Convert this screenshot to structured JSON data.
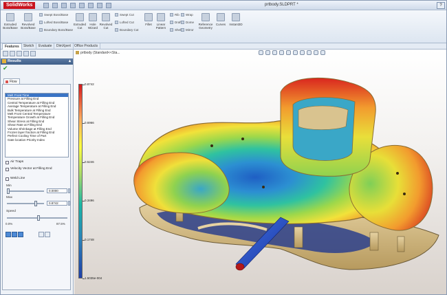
{
  "app": {
    "logo": "SolidWorks",
    "document_title": "prtbody.SLDPRT *",
    "help": "?"
  },
  "ribbon": {
    "commands": [
      "Extruded Boss/Base",
      "Revolved Boss/Base",
      "Extruded Cut",
      "Hole Wizard",
      "Revolved Cut",
      "Fillet",
      "Linear Pattern",
      "Reference Geometry",
      "Curves",
      "Instant3D"
    ],
    "small_commands": [
      "Swept Boss/Base",
      "Lofted Boss/Base",
      "Boundary Boss/Base",
      "Swept Cut",
      "Lofted Cut",
      "Boundary Cut",
      "Rib",
      "Draft",
      "Shell",
      "Wrap",
      "Dome",
      "Mirror"
    ]
  },
  "command_tabs": [
    "Features",
    "Sketch",
    "Evaluate",
    "DimXpert",
    "Office Products"
  ],
  "panel": {
    "header": "Results",
    "ok_symbol": "✔",
    "tab": "Flow",
    "results_list": [
      "Melt Front Time",
      "Pressure at Filling End",
      "Central Temperature at Filling End",
      "Average Temperature at Filling End",
      "Bulk Temperature at Filling End",
      "Melt Front Central Temperature",
      "Temperature Growth at Filling End",
      "Shear Stress at Filling End",
      "Shear Rate at Filling End",
      "Volume Shrinkage at Filling End",
      "Frozen layer fraction at Filling End",
      "Perfect Cooling Time of Part",
      "Gate location Priority Index"
    ],
    "selected_result": "Melt Front Time",
    "air_traps_label": "Air Traps",
    "velocity_label": "Velocity Vector at Filling End",
    "weld_label": "Weld Line",
    "min_label": "Min",
    "min_value": "0.0000",
    "max_label": "Max",
    "max_value": "0.8742",
    "speed_label": "Speed",
    "speed_min": "0.0%",
    "speed_max": "87.5%"
  },
  "viewport": {
    "tree_label": "prtbody (Standard<<Sta...",
    "legend": {
      "labels": [
        "0.8742",
        "0.6966",
        "0.5246",
        "0.3496",
        "0.1748",
        "1.5035e-004"
      ]
    }
  },
  "colors": {
    "legend_high": "#d7191c",
    "legend_mid": "#ffff40",
    "legend_low": "#1f3fa8",
    "ok_green": "#2f9e2f",
    "tab_accent": "#3a74c5"
  }
}
